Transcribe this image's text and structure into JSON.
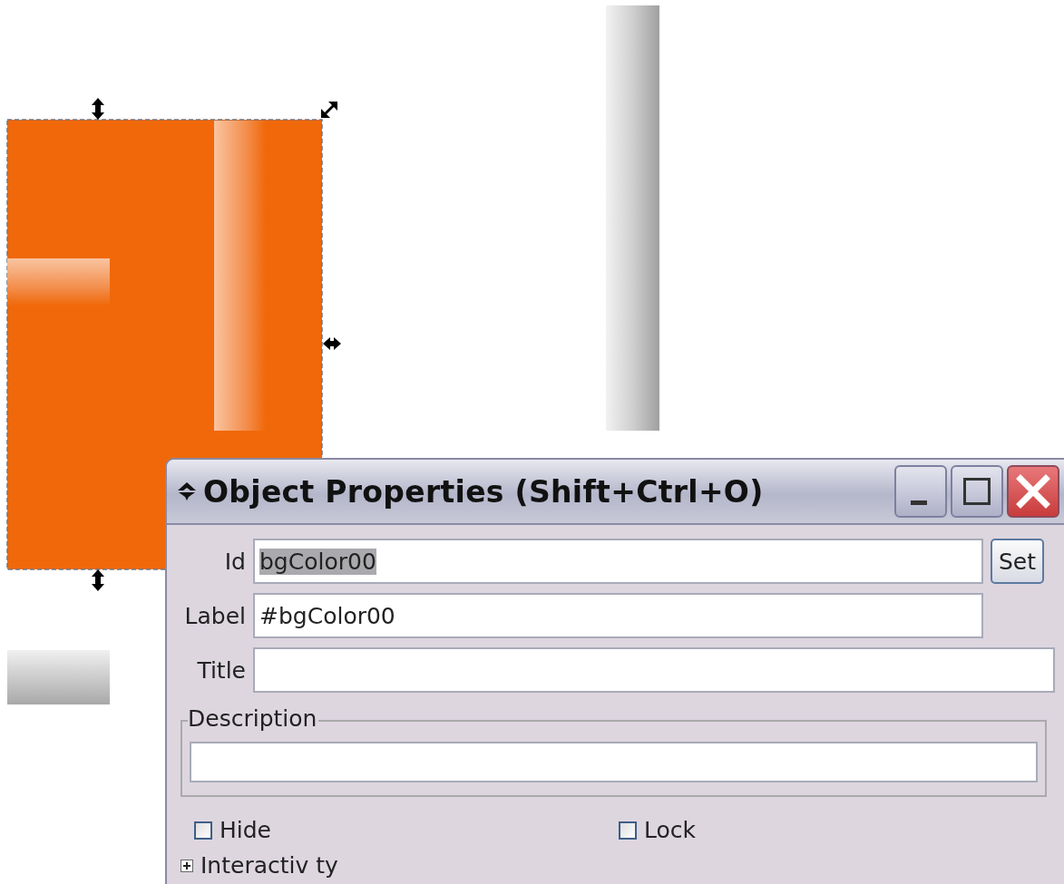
{
  "dialog": {
    "title": "Object Properties (Shift+Ctrl+O)",
    "fields": [
      {
        "kind": "button",
        "label": "Id",
        "value": "bgColor00",
        "text_selected": true,
        "button": "Set"
      },
      {
        "kind": "short",
        "label": "Label",
        "value": "#bgColor00"
      },
      {
        "kind": "wide",
        "label": "Title"
      }
    ],
    "description": {
      "label": "Description"
    },
    "checkboxes": [
      {
        "label": "Hide",
        "checked": false
      },
      {
        "label": "Lock",
        "checked": false
      }
    ],
    "expander": {
      "label": "Interactiv ty",
      "expanded": false
    }
  }
}
